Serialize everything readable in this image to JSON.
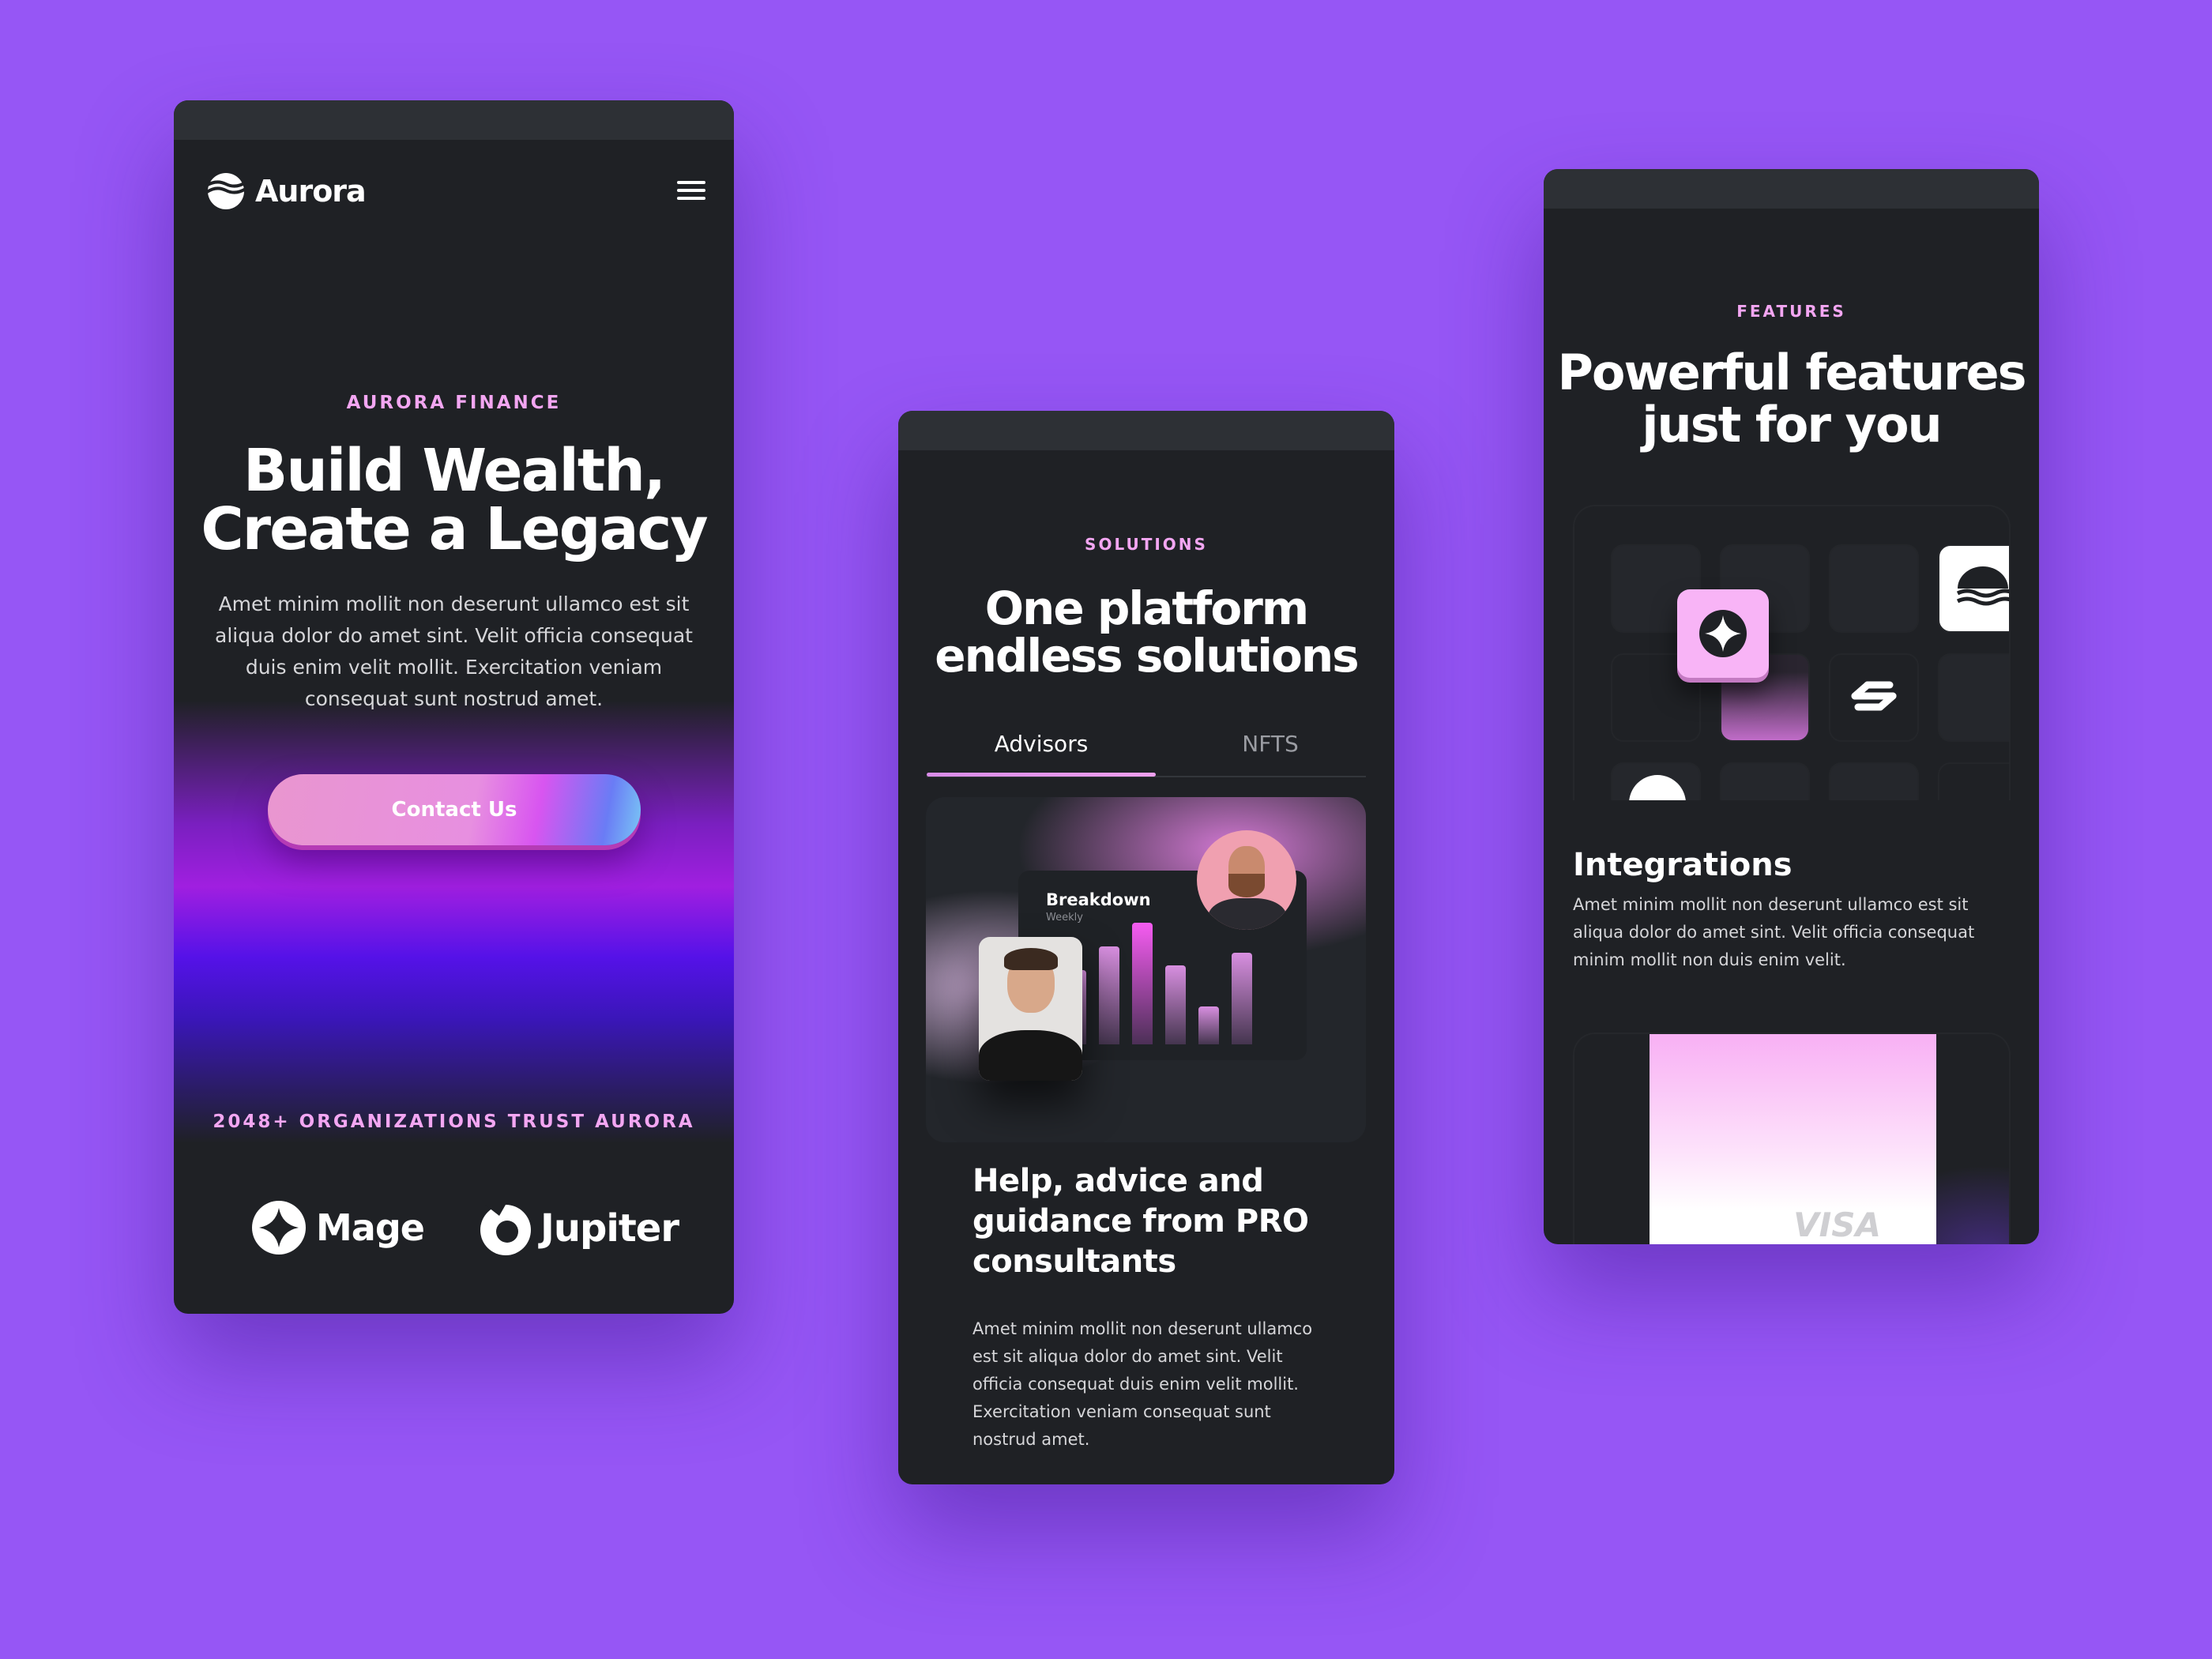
{
  "colors": {
    "background": "#9656f5",
    "card": "#1f2125",
    "accent": "#f3a6f2"
  },
  "screen1": {
    "brand": "Aurora",
    "eyebrow": "AURORA FINANCE",
    "headline_line1": "Build Wealth,",
    "headline_line2": "Create a Legacy",
    "body": "Amet minim mollit non deserunt ullamco est sit aliqua dolor do amet sint. Velit officia consequat duis enim velit mollit. Exercitation veniam consequat sunt nostrud amet.",
    "cta": "Contact Us",
    "trust": "2048+ ORGANIZATIONS TRUST AURORA",
    "logos": [
      {
        "name": "Mage",
        "icon": "sparkle-badge-icon"
      },
      {
        "name": "Jupiter",
        "icon": "jupiter-ring-icon"
      }
    ]
  },
  "screen2": {
    "eyebrow": "SOLUTIONS",
    "headline_line1": "One platform",
    "headline_line2": "endless solutions",
    "tabs": [
      {
        "label": "Advisors",
        "active": true
      },
      {
        "label": "NFTS",
        "active": false
      }
    ],
    "card": {
      "title": "Breakdown",
      "subtitle": "Weekly",
      "bar_levels": [
        0.47,
        0.62,
        0.77,
        0.5,
        0.24,
        0.58
      ]
    },
    "feature_title": "Help, advice and guidance from PRO consultants",
    "feature_body": "Amet minim mollit non deserunt ullamco est sit aliqua dolor do amet sint. Velit officia consequat duis enim velit mollit. Exercitation veniam consequat sunt nostrud amet."
  },
  "screen3": {
    "eyebrow": "FEATURES",
    "headline_line1": "Powerful features",
    "headline_line2": "just for you",
    "section_title": "Integrations",
    "section_body": "Amet minim mollit non deserunt ullamco est sit aliqua dolor do amet sint. Velit officia consequat minim mollit non duis enim velit.",
    "card_brand": "VISA"
  }
}
